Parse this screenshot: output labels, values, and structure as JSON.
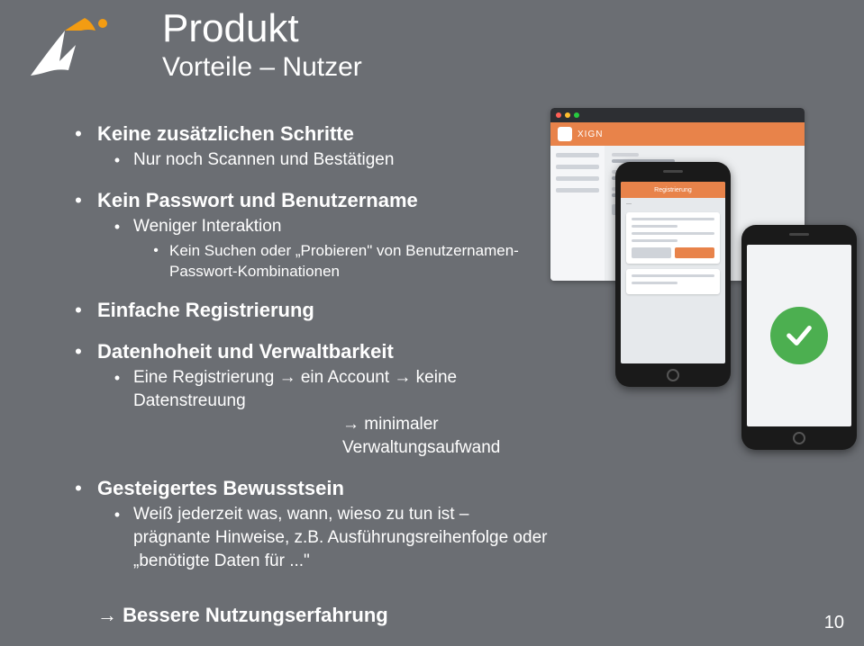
{
  "title": "Produkt",
  "subtitle": "Vorteile – Nutzer",
  "bullets": {
    "b1": "Keine zusätzlichen Schritte",
    "b1a": "Nur noch Scannen und Bestätigen",
    "b2": "Kein Passwort und Benutzername",
    "b2a": "Weniger Interaktion",
    "b2a1": "Kein Suchen oder „Probieren\" von Benutzernamen-Passwort-Kombinationen",
    "b3": "Einfache Registrierung",
    "b4": "Datenhoheit und Verwaltbarkeit",
    "b4a": "Eine Registrierung → ein Account → keine Datenstreuung",
    "b4a_cont": "→ minimaler Verwaltungsaufwand",
    "b5": "Gesteigertes Bewusstsein",
    "b5a": "Weiß jederzeit was, wann, wieso zu tun ist – prägnante Hinweise, z.B. Ausführungsreihenfolge oder „benötigte Daten für ...\""
  },
  "conclusion": "→ Bessere Nutzungserfahrung",
  "page_number": "10",
  "mock": {
    "brand": "XIGN",
    "phone_head": "Registrierung"
  }
}
